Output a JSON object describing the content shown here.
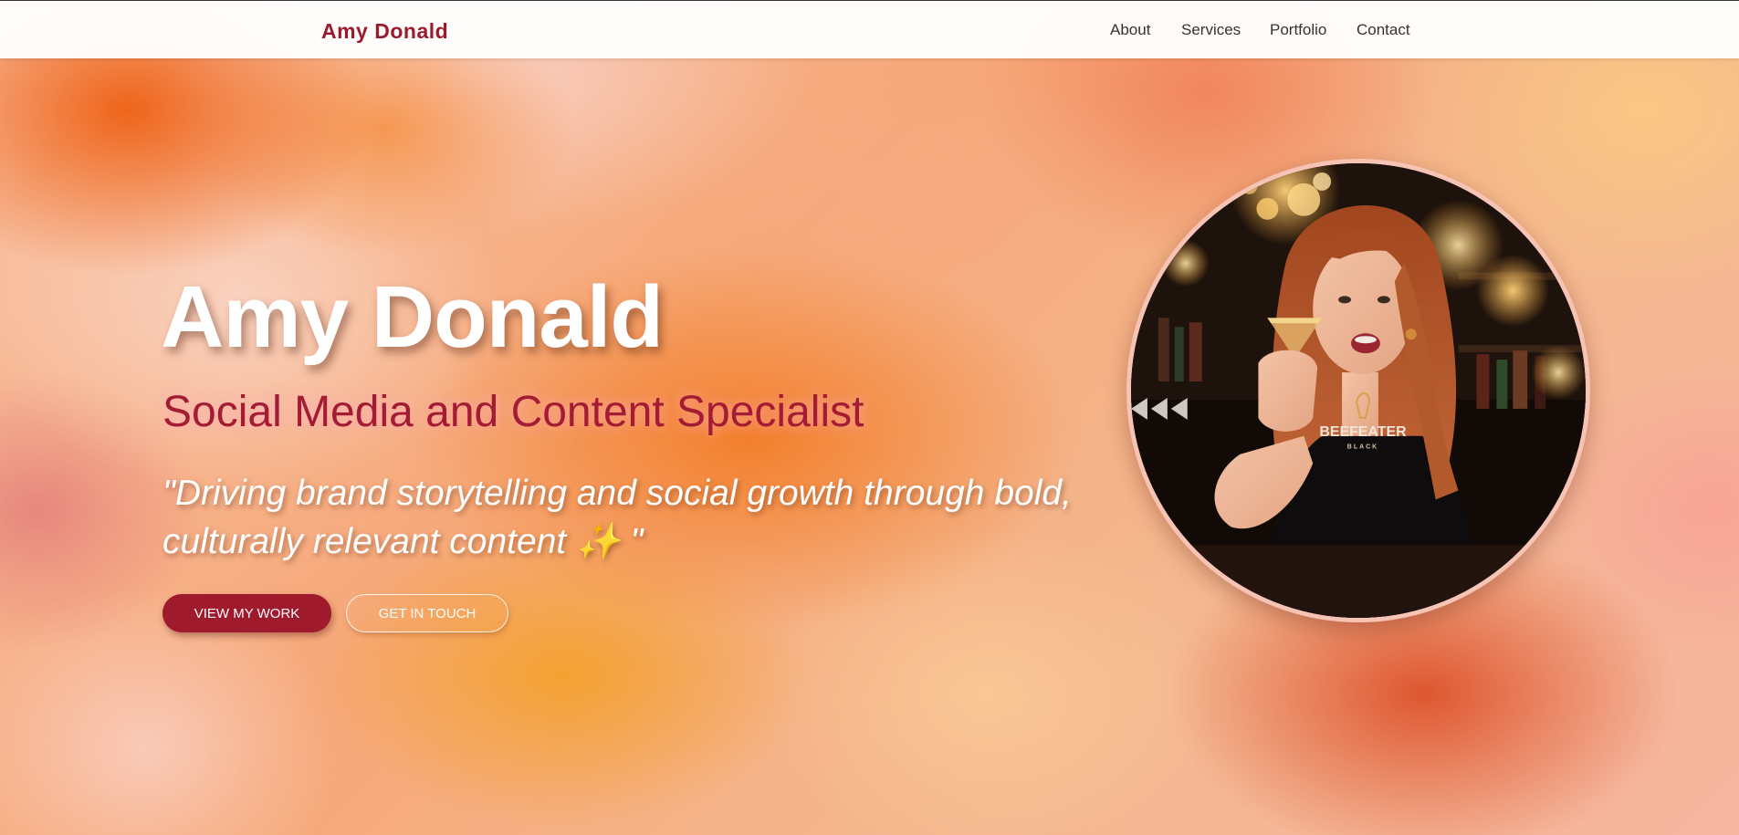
{
  "nav": {
    "brand": "Amy Donald",
    "links": [
      {
        "label": "About"
      },
      {
        "label": "Services"
      },
      {
        "label": "Portfolio"
      },
      {
        "label": "Contact"
      }
    ]
  },
  "hero": {
    "name": "Amy Donald",
    "role": "Social Media and Content Specialist",
    "quote": "\"Driving brand storytelling and social growth through bold, culturally relevant content ✨ \"",
    "primary_button": "View My Work",
    "secondary_button": "Get In Touch",
    "portrait_shirt_logo": "BEEFEATER",
    "portrait_shirt_logo_sub": "BLACK"
  },
  "colors": {
    "brand": "#9b1b2c",
    "primary_button": "#a01a2d",
    "role_text": "#a41b34",
    "nav_background": "#ffffff"
  },
  "icons": {
    "sparkle": "sparkles-emoji"
  }
}
